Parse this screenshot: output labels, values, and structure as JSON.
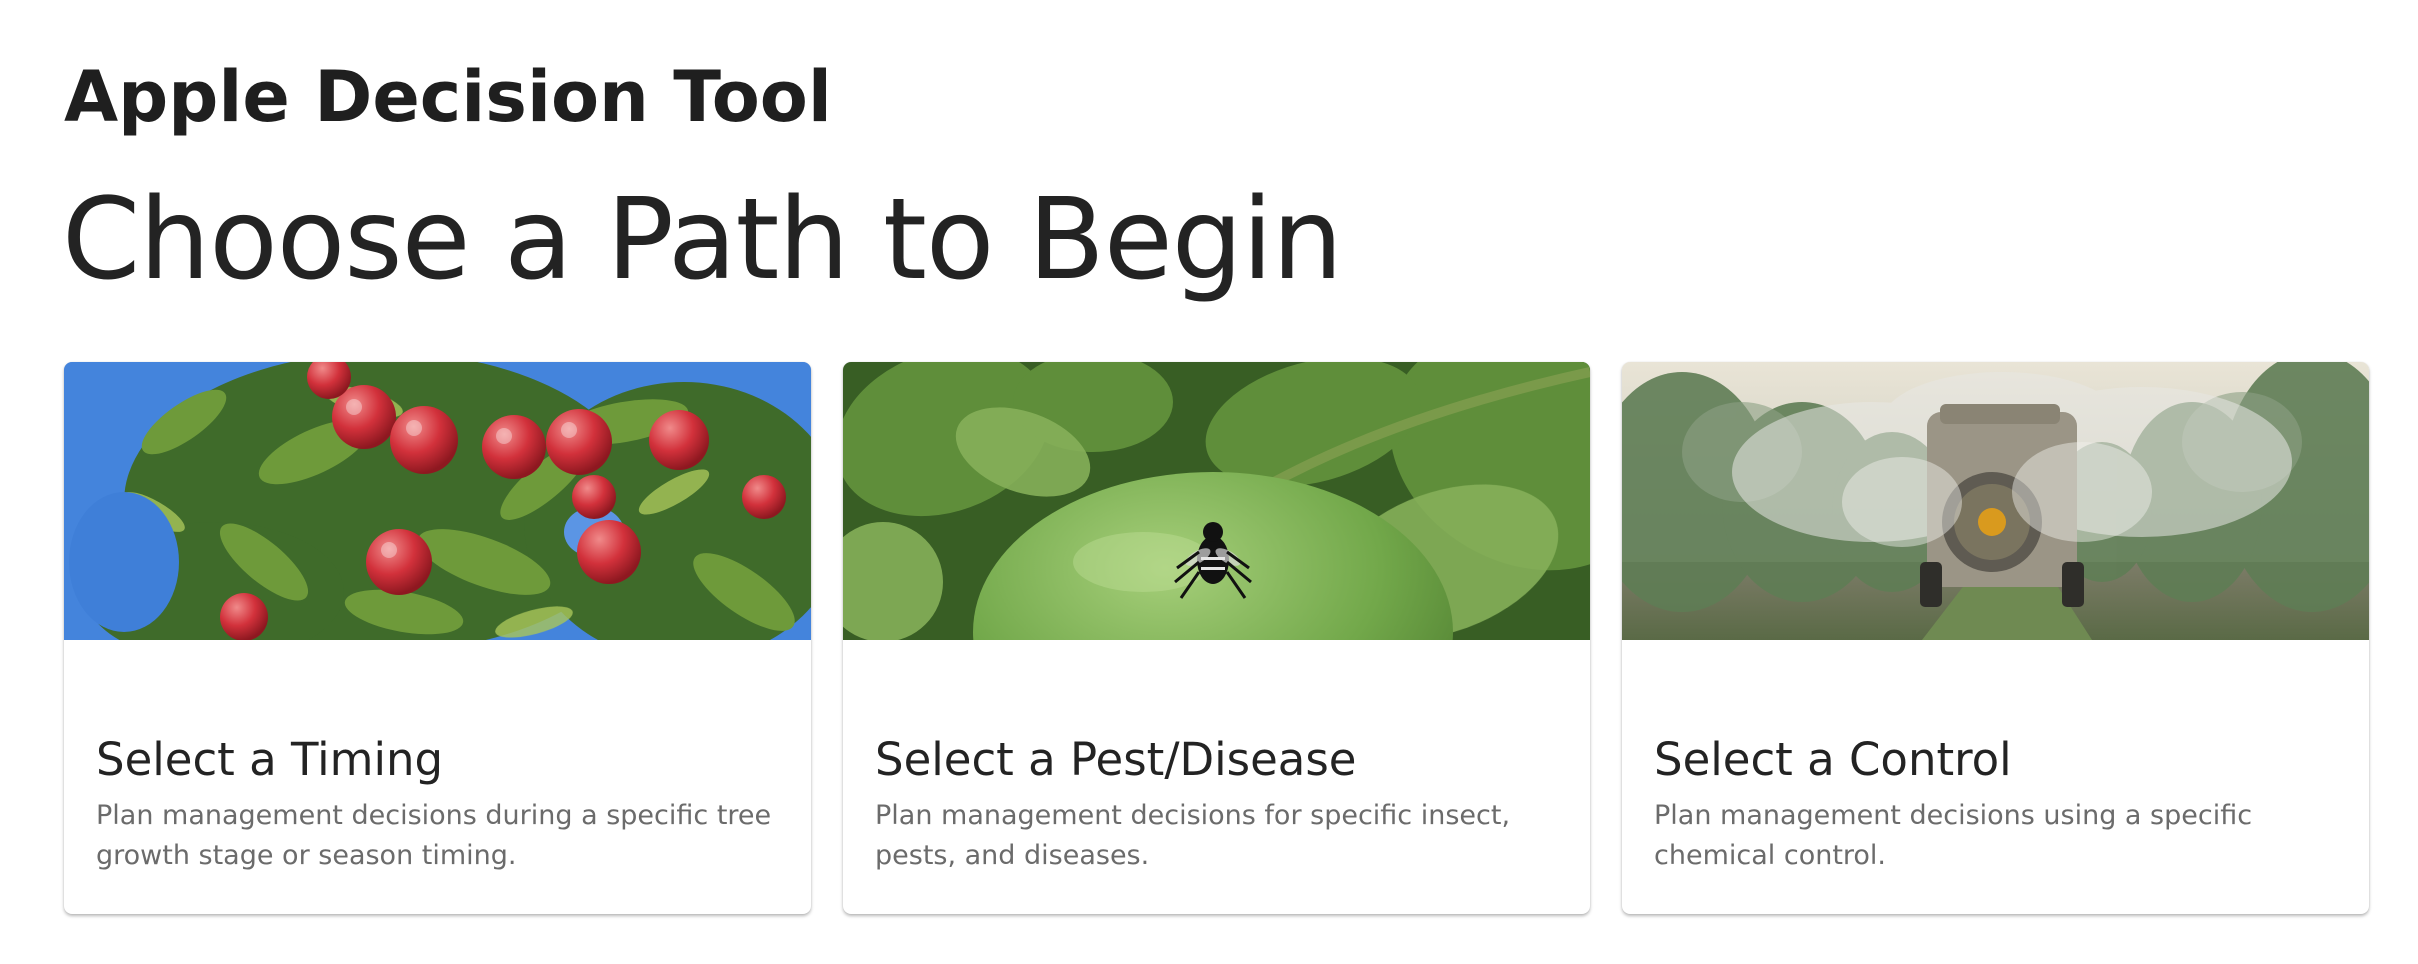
{
  "header": {
    "app_title": "Apple Decision Tool",
    "page_heading": "Choose a Path to Begin"
  },
  "cards": [
    {
      "title": "Select a Timing",
      "description": "Plan management decisions during a specific tree growth stage or season timing.",
      "image_icon": "apple-tree-photo"
    },
    {
      "title": "Select a Pest/Disease",
      "description": "Plan management decisions for specific insect, pests, and diseases.",
      "image_icon": "insect-on-apple-photo"
    },
    {
      "title": "Select a Control",
      "description": "Plan management decisions using a specific chemical control.",
      "image_icon": "orchard-sprayer-photo"
    }
  ],
  "colors": {
    "text_primary": "#232323",
    "text_secondary": "#6b6b6b",
    "background": "#ffffff"
  }
}
